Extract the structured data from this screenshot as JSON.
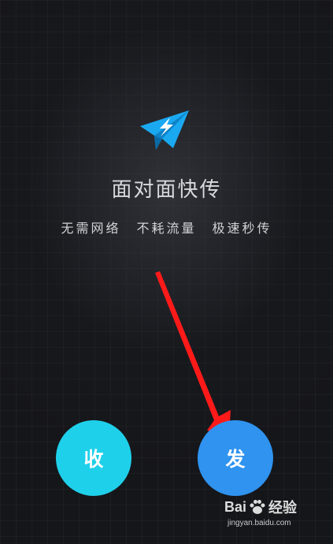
{
  "app": {
    "title": "面对面快传",
    "features": [
      "无需网络",
      "不耗流量",
      "极速秒传"
    ]
  },
  "buttons": {
    "receive_label": "收",
    "send_label": "发"
  },
  "watermark": {
    "brand_left": "Bai",
    "brand_right": "经验",
    "url": "jingyan.baidu.com"
  },
  "icons": {
    "logo": "paper-plane-lightning-icon",
    "annotation": "red-arrow-icon",
    "watermark": "paw-icon"
  },
  "colors": {
    "logo": "#1aa9f0",
    "receive_button": "#1fd0ea",
    "send_button": "#2f93ef",
    "annotation_arrow": "#ff1a1a"
  }
}
